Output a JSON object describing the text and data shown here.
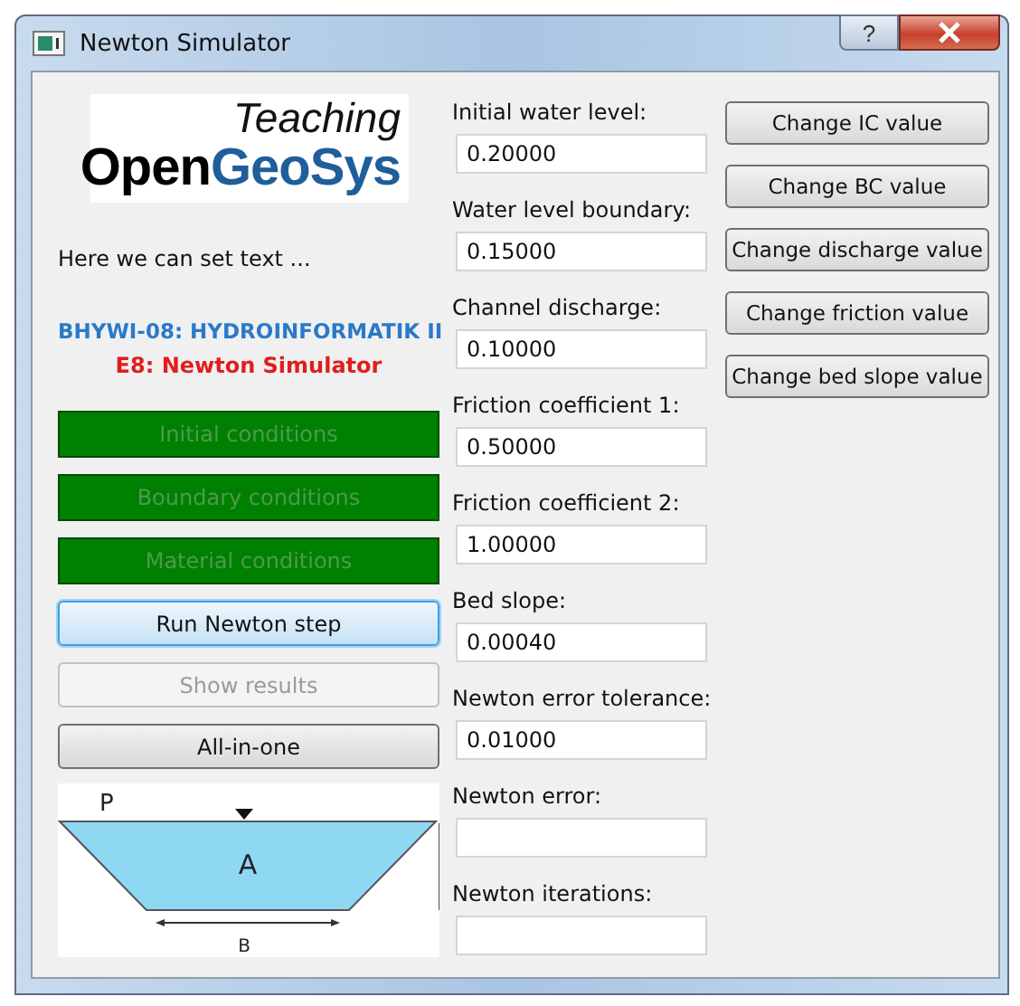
{
  "window": {
    "title": "Newton Simulator",
    "help_button": "?"
  },
  "logo": {
    "top": "Teaching",
    "main": "Open",
    "main_accent": "GeoSys"
  },
  "info_text": "Here we can set text ...",
  "course": {
    "code": "BHYWI-08: HYDROINFORMATIK II",
    "title": "E8: Newton Simulator"
  },
  "left_buttons": [
    {
      "label": "Initial conditions",
      "kind": "colored",
      "disabled": true,
      "focused": false
    },
    {
      "label": "Boundary conditions",
      "kind": "colored",
      "disabled": true,
      "focused": false
    },
    {
      "label": "Material conditions",
      "kind": "colored",
      "disabled": true,
      "focused": false
    },
    {
      "label": "Run Newton step",
      "kind": "plain",
      "disabled": false,
      "focused": true
    },
    {
      "label": "Show results",
      "kind": "plain",
      "disabled": true,
      "focused": false
    },
    {
      "label": "All-in-one",
      "kind": "plain",
      "disabled": false,
      "focused": false
    }
  ],
  "diagram": {
    "top_label": "P",
    "area_label": "A",
    "width_label": "B"
  },
  "fields": [
    {
      "label": "Initial water level:",
      "value": "0.20000"
    },
    {
      "label": "Water level boundary:",
      "value": "0.15000"
    },
    {
      "label": "Channel discharge:",
      "value": "0.10000"
    },
    {
      "label": "Friction coefficient 1:",
      "value": "0.50000"
    },
    {
      "label": "Friction coefficient 2:",
      "value": "1.00000"
    },
    {
      "label": "Bed slope:",
      "value": "0.00040"
    },
    {
      "label": "Newton error tolerance:",
      "value": "0.01000"
    },
    {
      "label": "Newton error:"
    },
    {
      "label": "Newton iterations:"
    }
  ],
  "right_buttons": [
    "Change IC value",
    "Change BC value",
    "Change discharge value",
    "Change friction value",
    "Change bed slope value"
  ]
}
